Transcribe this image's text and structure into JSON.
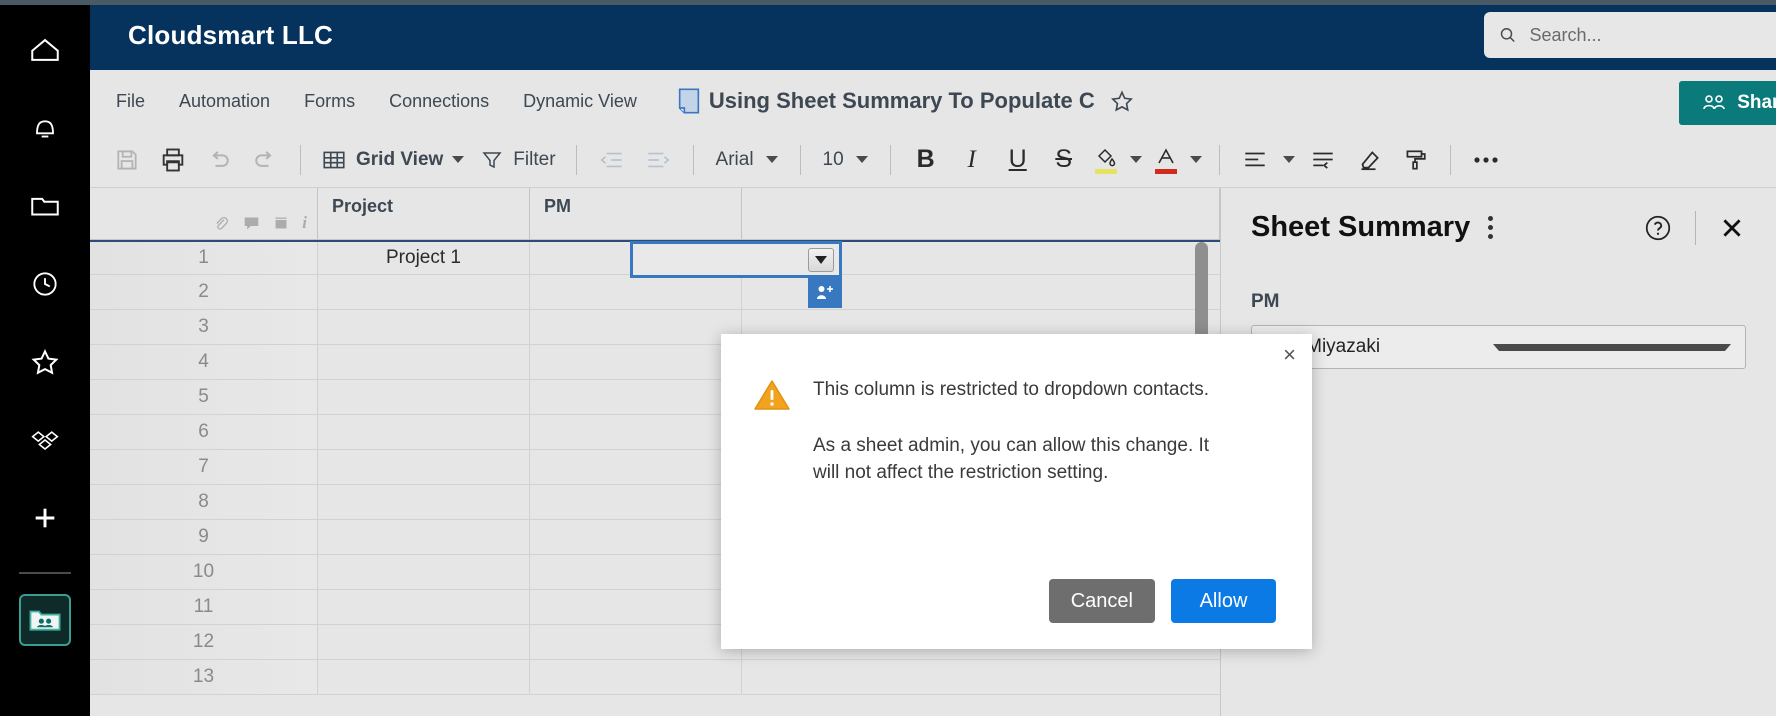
{
  "rail": {
    "items": [
      {
        "name": "home-icon",
        "label": "Home"
      },
      {
        "name": "notifications-icon",
        "label": "Notifications"
      },
      {
        "name": "browse-folder-icon",
        "label": "Browse"
      },
      {
        "name": "recents-clock-icon",
        "label": "Recents"
      },
      {
        "name": "favorites-star-icon",
        "label": "Favorites"
      },
      {
        "name": "solutions-icon",
        "label": "Solution Center"
      },
      {
        "name": "create-plus-icon",
        "label": "Create"
      }
    ],
    "active_item": {
      "name": "workspace-contacts-icon",
      "label": "Workspace"
    }
  },
  "topbar": {
    "title": "Cloudsmart LLC",
    "search_placeholder": "Search...",
    "search_value": ""
  },
  "menubar": {
    "items": [
      "File",
      "Automation",
      "Forms",
      "Connections",
      "Dynamic View"
    ],
    "doc_title": "Using Sheet Summary To Populate C",
    "share_label": "Share"
  },
  "toolbar": {
    "left_icons": [
      {
        "name": "save-icon",
        "disabled": true
      },
      {
        "name": "print-icon",
        "disabled": false
      },
      {
        "name": "undo-icon",
        "disabled": true
      },
      {
        "name": "redo-icon",
        "disabled": true
      }
    ],
    "view_label": "Grid View",
    "filter_label": "Filter",
    "indent_icons": [
      {
        "name": "decrease-indent-icon",
        "disabled": true
      },
      {
        "name": "increase-indent-icon",
        "disabled": true
      }
    ],
    "font_family": "Arial",
    "font_size": "10",
    "format_icons": [
      {
        "name": "bold-icon",
        "glyph": "B"
      },
      {
        "name": "italic-icon",
        "glyph": "I"
      },
      {
        "name": "underline-icon",
        "glyph": "U"
      },
      {
        "name": "strikethrough-icon",
        "glyph": "S"
      }
    ],
    "fill_color": "#e6e264",
    "font_color": "#d12b20",
    "right_icons": [
      {
        "name": "align-left-icon"
      },
      {
        "name": "wrap-text-icon"
      },
      {
        "name": "clear-formatting-icon"
      },
      {
        "name": "format-painter-icon"
      },
      {
        "name": "more-options-icon"
      }
    ]
  },
  "grid": {
    "row_icons": [
      "attachment-icon",
      "comment-icon",
      "proof-icon",
      "info-icon"
    ],
    "columns": [
      "Project",
      "PM"
    ],
    "rows": [
      {
        "num": "1",
        "project": "Project 1",
        "pm": ""
      },
      {
        "num": "2",
        "project": "",
        "pm": ""
      },
      {
        "num": "3",
        "project": "",
        "pm": ""
      },
      {
        "num": "4",
        "project": "",
        "pm": ""
      },
      {
        "num": "5",
        "project": "",
        "pm": ""
      },
      {
        "num": "6",
        "project": "",
        "pm": ""
      },
      {
        "num": "7",
        "project": "",
        "pm": ""
      },
      {
        "num": "8",
        "project": "",
        "pm": ""
      },
      {
        "num": "9",
        "project": "",
        "pm": ""
      },
      {
        "num": "10",
        "project": "",
        "pm": ""
      },
      {
        "num": "11",
        "project": "",
        "pm": ""
      },
      {
        "num": "12",
        "project": "",
        "pm": ""
      },
      {
        "num": "13",
        "project": "",
        "pm": ""
      }
    ],
    "selected_cell": {
      "row": "1",
      "column": "PM",
      "value": ""
    }
  },
  "panel": {
    "title": "Sheet Summary",
    "field_label": "PM",
    "field_value": "Juni Miyazaki"
  },
  "modal": {
    "line1": "This column is restricted to dropdown contacts.",
    "line2": "As a sheet admin, you can allow this change. It will not affect the restriction setting.",
    "cancel_label": "Cancel",
    "allow_label": "Allow",
    "close_glyph": "×",
    "accent_allow": "#0b7ae5",
    "accent_cancel": "#6e6e6e",
    "warning_color": "#f2a21d"
  }
}
